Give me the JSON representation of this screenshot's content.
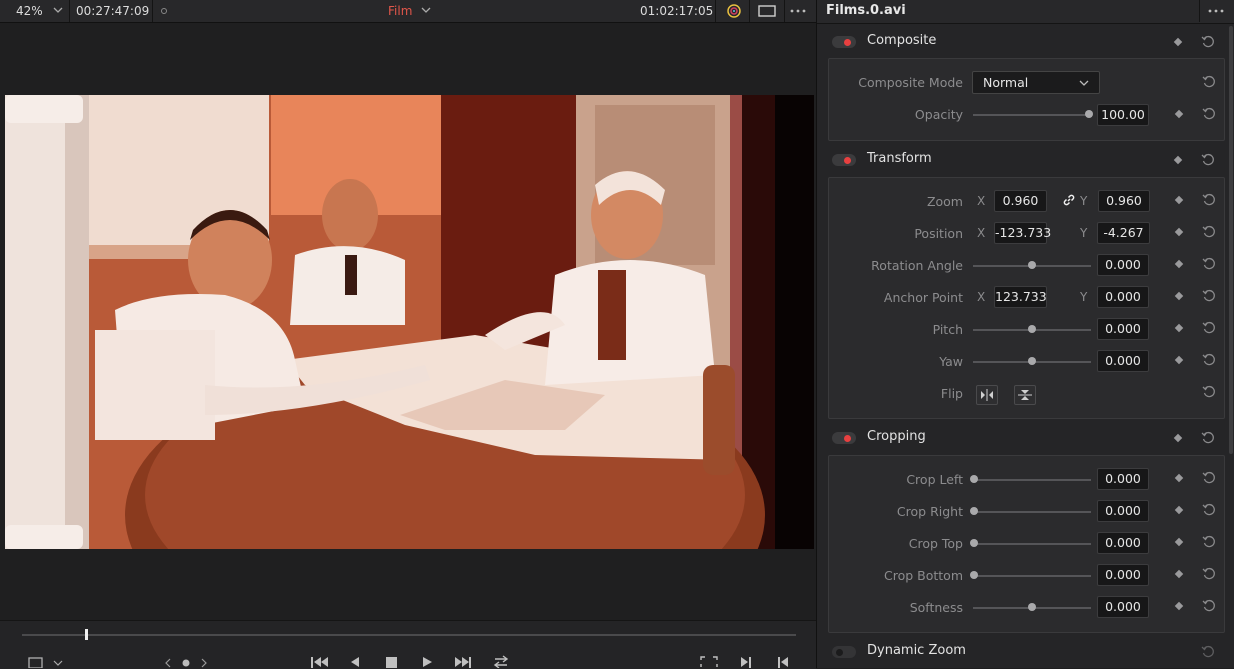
{
  "viewer": {
    "zoom": "42%",
    "source_timecode": "00:27:47:09",
    "clip_title": "Film",
    "record_timecode": "01:02:17:05"
  },
  "inspector": {
    "clip_name": "Films.0.avi",
    "composite": {
      "title": "Composite",
      "mode_label": "Composite Mode",
      "mode_value": "Normal",
      "opacity_label": "Opacity",
      "opacity_value": "100.00",
      "opacity_level": 1.0
    },
    "transform": {
      "title": "Transform",
      "zoom_label": "Zoom",
      "zoom_x": "0.960",
      "zoom_y": "0.960",
      "position_label": "Position",
      "position_x": "-123.733",
      "position_y": "-4.267",
      "rotation_label": "Rotation Angle",
      "rotation_value": "0.000",
      "anchor_label": "Anchor Point",
      "anchor_x": "123.733",
      "anchor_y": "0.000",
      "pitch_label": "Pitch",
      "pitch_value": "0.000",
      "yaw_label": "Yaw",
      "yaw_value": "0.000",
      "flip_label": "Flip",
      "x_axis": "X",
      "y_axis": "Y"
    },
    "cropping": {
      "title": "Cropping",
      "crop_left_label": "Crop Left",
      "crop_left_value": "0.000",
      "crop_right_label": "Crop Right",
      "crop_right_value": "0.000",
      "crop_top_label": "Crop Top",
      "crop_top_value": "0.000",
      "crop_bottom_label": "Crop Bottom",
      "crop_bottom_value": "0.000",
      "softness_label": "Softness",
      "softness_value": "0.000"
    },
    "dynamic_zoom": {
      "title": "Dynamic Zoom"
    }
  },
  "colors": {
    "accent_red": "#e84040",
    "panel_bg": "#2b2b2d",
    "film_orange": "#c9633e"
  },
  "icons": [
    "chevron-down-icon",
    "link-icon",
    "keyframe-icon",
    "reset-icon",
    "more-icon",
    "color-wheel-icon",
    "viewer-mode-icon",
    "crop-tool-icon",
    "skip-start-icon",
    "prev-frame-icon",
    "stop-icon",
    "play-icon",
    "skip-end-icon",
    "loop-icon",
    "match-frame-icon",
    "next-edit-icon",
    "prev-edit-icon",
    "flip-horizontal-icon",
    "flip-vertical-icon"
  ]
}
